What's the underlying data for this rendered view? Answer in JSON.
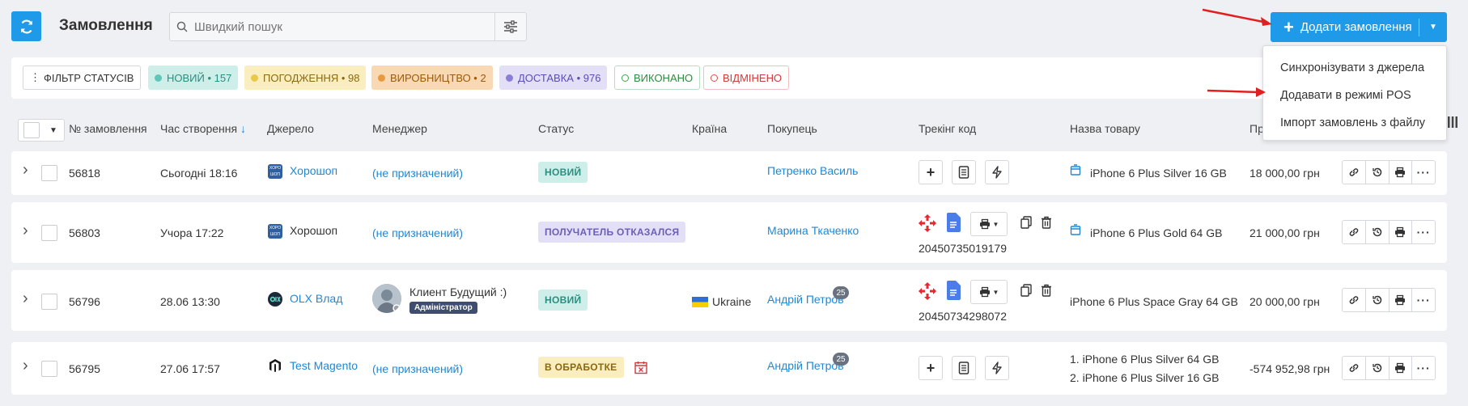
{
  "header": {
    "title": "Замовлення",
    "search_placeholder": "Швидкий пошук",
    "add_order_label": "Додати замовлення"
  },
  "dropdown": {
    "items": [
      "Синхронізувати з джерела",
      "Додавати в режимі POS",
      "Імпорт замовлень з файлу"
    ]
  },
  "status_filter": {
    "filter_label": "ФІЛЬТР СТАТУСІВ",
    "chips": [
      {
        "label": "НОВИЙ",
        "count": "157",
        "color": "#5fc7b9"
      },
      {
        "label": "ПОГОДЖЕННЯ",
        "count": "98",
        "color": "#e8c94a"
      },
      {
        "label": "ВИРОБНИЦТВО",
        "count": "2",
        "color": "#e89a3e"
      },
      {
        "label": "ДОСТАВКА",
        "count": "976",
        "color": "#8a7fd6"
      },
      {
        "label": "ВИКОНАНО",
        "count": "",
        "color": "#39a84d"
      },
      {
        "label": "ВІДМІНЕНО",
        "count": "",
        "color": "#e04d4d"
      }
    ]
  },
  "columns": [
    "№ замовлення",
    "Час створення",
    "Джерело",
    "Менеджер",
    "Статус",
    "Країна",
    "Покупець",
    "Трекінг код",
    "Назва товару",
    "Пр"
  ],
  "rows": [
    {
      "id": "56818",
      "created": "Сьогодні 18:16",
      "source": "Хорошоп",
      "manager": "(не призначений)",
      "status": "НОВИЙ",
      "country": "",
      "buyer": "Петренко Василь",
      "tracking": "",
      "product": "iPhone 6 Plus Silver 16 GB",
      "price": "18 000,00 грн"
    },
    {
      "id": "56803",
      "created": "Учора 17:22",
      "source": "Хорошоп",
      "manager": "(не призначений)",
      "status": "ПОЛУЧАТЕЛЬ ОТКАЗАЛСЯ",
      "country": "",
      "buyer": "Марина Ткаченко",
      "tracking": "20450735019179",
      "product": "iPhone 6 Plus Gold 64 GB",
      "price": "21 000,00 грн"
    },
    {
      "id": "56796",
      "created": "28.06 13:30",
      "source": "OLX Влад",
      "manager": "Клиент Будущий :)",
      "manager_role": "Адміністратор",
      "status": "НОВИЙ",
      "country": "Ukraine",
      "buyer": "Андрій Петров",
      "buyer_count": "25",
      "tracking": "20450734298072",
      "product": "iPhone 6 Plus Space Gray 64 GB",
      "price": "20 000,00 грн"
    },
    {
      "id": "56795",
      "created": "27.06 17:57",
      "source": "Test Magento",
      "manager": "(не призначений)",
      "status": "В ОБРАБОТКЕ",
      "country": "",
      "buyer": "Андрій Петров",
      "buyer_count": "25",
      "tracking": "",
      "product_lines": [
        "1. iPhone 6 Plus Silver 64 GB",
        "2. iPhone 6 Plus Silver 16 GB"
      ],
      "price": "-574 952,98 грн"
    }
  ],
  "source_logo_text": "ХОРО ШОП",
  "colors": {
    "accent": "#1e9ae8",
    "link": "#1e88d6",
    "annotation_arrow": "#e02020"
  }
}
